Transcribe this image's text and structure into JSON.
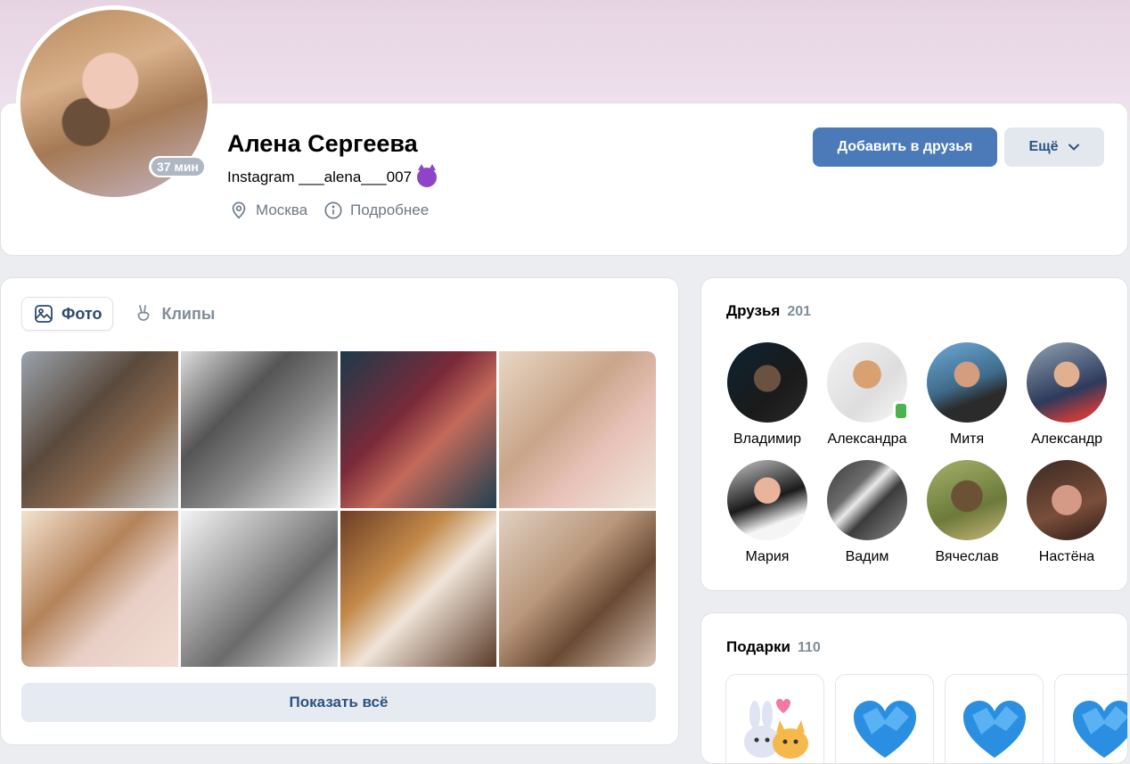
{
  "profile": {
    "name": "Алена Сергеева",
    "status": "Instagram ___alena___007",
    "status_emoji": "devil-emoji",
    "online": "37 мин",
    "city": "Москва",
    "details_link": "Подробнее"
  },
  "actions": {
    "add_friend": "Добавить в друзья",
    "more": "Ещё"
  },
  "photos": {
    "tabs": [
      {
        "label": "Фото",
        "icon": "photo-icon",
        "active": true
      },
      {
        "label": "Клипы",
        "icon": "clips-icon",
        "active": false
      }
    ],
    "count_shown": 8,
    "show_all": "Показать всё"
  },
  "friends": {
    "title": "Друзья",
    "count": "201",
    "items": [
      {
        "name": "Владимир"
      },
      {
        "name": "Александра",
        "mobile_online": true
      },
      {
        "name": "Митя"
      },
      {
        "name": "Александр"
      },
      {
        "name": "Мария"
      },
      {
        "name": "Вадим"
      },
      {
        "name": "Вячеслав"
      },
      {
        "name": "Настёна"
      }
    ]
  },
  "gifts": {
    "title": "Подарки",
    "count": "110",
    "items": [
      "bunny-cat-gift",
      "blue-heart-gift",
      "blue-heart-gift",
      "blue-heart-gift"
    ]
  },
  "colors": {
    "accent": "#4a7bb8",
    "secondary_button": "#e3e8ef",
    "muted_text": "#818c99",
    "online_mobile": "#4bb34b"
  }
}
